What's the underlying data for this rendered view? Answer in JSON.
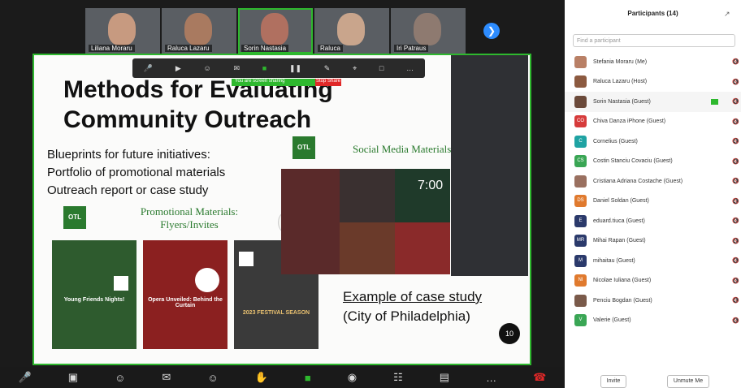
{
  "thumbnails": [
    {
      "name": "Liliana Moraru"
    },
    {
      "name": "Raluca Lazaru"
    },
    {
      "name": "Sorin Nastasia"
    },
    {
      "name": "Raluca"
    },
    {
      "name": "Iri Patraus"
    }
  ],
  "floatbar": [
    "Audio",
    "Video",
    "Participants",
    "Chat",
    "Share",
    "Pause",
    "Annotate",
    "Remote Control",
    "Stop Sharing",
    "More"
  ],
  "share_banner": "You are screen sharing",
  "stop_share": "Stop Share",
  "slide": {
    "title_line1": "Methods for Evaluating",
    "title_line2": "Community Outreach",
    "bullets": [
      "Blueprints for future initiatives:",
      "Portfolio of promotional materials",
      "Outreach report or case study"
    ],
    "social_label": "Social Media Materials",
    "promo_label_1": "Promotional Materials:",
    "promo_label_2": "Flyers/Invites",
    "logo_text": "OTL",
    "cards": [
      {
        "title": "Young Friends Nights!",
        "color": "#2e5b2e"
      },
      {
        "title": "Opera Unveiled: Behind the Curtain",
        "color": "#8b2020"
      },
      {
        "title": "2023 FESTIVAL SEASON",
        "color": "#3a3a3a"
      }
    ],
    "grid_time": "7:00",
    "case_line1": "Example of case study",
    "case_line2": "(City of Philadelphia)",
    "page_number": "10"
  },
  "controls": [
    "Audio",
    "Video",
    "Participants",
    "Chat",
    "React",
    "Raise Hand",
    "Share",
    "Record",
    "Summary",
    "Captions",
    "More",
    "End"
  ],
  "participants_panel": {
    "title": "Participants (14)",
    "search_placeholder": "Find a participant",
    "participants": [
      {
        "name": "Stefania Moraru (Me)",
        "initials": "",
        "color": "#b98066"
      },
      {
        "name": "Raluca Lazaru (Host)",
        "initials": "",
        "color": "#8c5a40"
      },
      {
        "name": "Sorin Nastasia (Guest)",
        "initials": "",
        "color": "#6b4a3a"
      },
      {
        "name": "Chiva Danza iPhone (Guest)",
        "initials": "CO",
        "color": "#d63b3b"
      },
      {
        "name": "Cornelius (Guest)",
        "initials": "C",
        "color": "#1fa3a3"
      },
      {
        "name": "Costin Stanciu Covaciu (Guest)",
        "initials": "CS",
        "color": "#3aa655"
      },
      {
        "name": "Cristiana Adriana Costache (Guest)",
        "initials": "",
        "color": "#9a7060"
      },
      {
        "name": "Daniel Soldan (Guest)",
        "initials": "DS",
        "color": "#e07a2e"
      },
      {
        "name": "eduard.tiuca (Guest)",
        "initials": "E",
        "color": "#2b3a6b"
      },
      {
        "name": "Mihai Rapan (Guest)",
        "initials": "MR",
        "color": "#2b3a6b"
      },
      {
        "name": "mihaitau (Guest)",
        "initials": "M",
        "color": "#2b3a6b"
      },
      {
        "name": "Nicolae Iuliana (Guest)",
        "initials": "NI",
        "color": "#e07a2e"
      },
      {
        "name": "Penciu Bogdan (Guest)",
        "initials": "",
        "color": "#7a5a4a"
      },
      {
        "name": "Valerie (Guest)",
        "initials": "V",
        "color": "#3aa655"
      }
    ],
    "invite": "Invite",
    "unmute_me": "Unmute Me"
  }
}
